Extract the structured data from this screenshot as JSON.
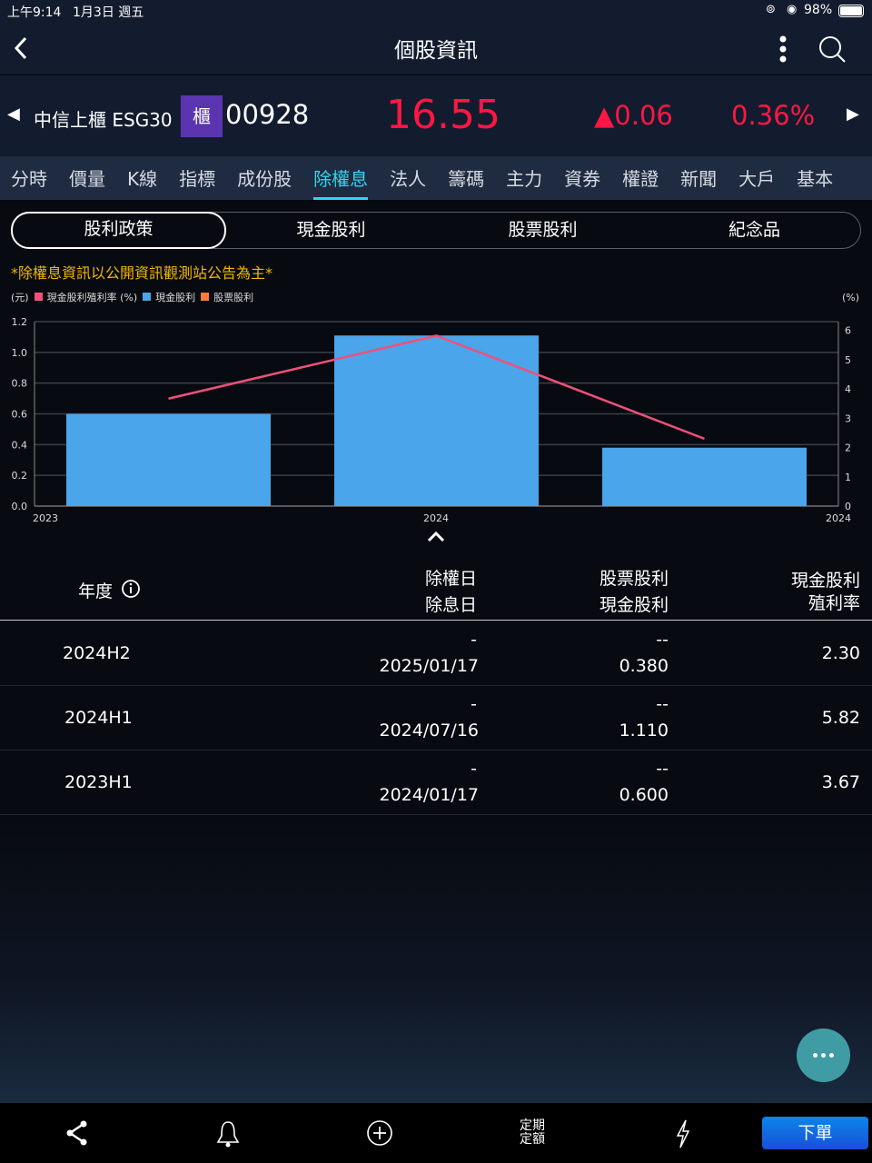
{
  "status": {
    "time": "上午9:14",
    "date": "1月3日 週五",
    "battery": "98%"
  },
  "header": {
    "title": "個股資訊"
  },
  "stock": {
    "name": "中信上櫃 ESG30",
    "market_badge": "櫃",
    "code": "00928",
    "price": "16.55",
    "change": "▲0.06",
    "change_pct": "0.36%",
    "badge_color": "#5b35b0",
    "up_color": "#ff1744"
  },
  "tabs": [
    "分時",
    "價量",
    "K線",
    "指標",
    "成份股",
    "除權息",
    "法人",
    "籌碼",
    "主力",
    "資券",
    "權證",
    "新聞",
    "大戶",
    "基本"
  ],
  "active_tab": "除權息",
  "segments": [
    "股利政策",
    "現金股利",
    "股票股利",
    "紀念品"
  ],
  "note": "*除權息資訊以公開資訊觀測站公告為主*",
  "chart_data": {
    "type": "bar",
    "left_unit": "(元)",
    "right_unit": "(%)",
    "legend": [
      {
        "label": "現金股利殖利率 (%)",
        "color": "#f0507a"
      },
      {
        "label": "現金股利",
        "color": "#4aa5ea"
      },
      {
        "label": "股票股利",
        "color": "#ff7a3a"
      }
    ],
    "categories": [
      "2023H1",
      "2024H1",
      "2024H2"
    ],
    "x_tick_labels": [
      "2023",
      "2024",
      "2024"
    ],
    "series": [
      {
        "name": "現金股利",
        "axis": "left",
        "type": "bar",
        "values": [
          0.6,
          1.11,
          0.38
        ]
      },
      {
        "name": "現金股利殖利率 (%)",
        "axis": "right",
        "type": "line",
        "values": [
          3.67,
          5.82,
          2.3
        ]
      }
    ],
    "ylim_left": [
      0,
      1.2
    ],
    "yticks_left": [
      "0.0",
      "0.2",
      "0.4",
      "0.6",
      "0.8",
      "1.0",
      "1.2"
    ],
    "ylim_right": [
      0,
      6.3
    ],
    "yticks_right": [
      "0",
      "1",
      "2",
      "3",
      "4",
      "5",
      "6"
    ],
    "grid": true
  },
  "table": {
    "headers": {
      "year": "年度",
      "ex_right": "除權日",
      "ex_div": "除息日",
      "stock_div": "股票股利",
      "cash_div": "現金股利",
      "yield1": "現金股利",
      "yield2": "殖利率"
    },
    "rows": [
      {
        "year": "2024H2",
        "ex_right": "-",
        "ex_div": "2025/01/17",
        "stock_div": "--",
        "cash_div": "0.380",
        "yield": "2.30"
      },
      {
        "year": "2024H1",
        "ex_right": "-",
        "ex_div": "2024/07/16",
        "stock_div": "--",
        "cash_div": "1.110",
        "yield": "5.82"
      },
      {
        "year": "2023H1",
        "ex_right": "-",
        "ex_div": "2024/01/17",
        "stock_div": "--",
        "cash_div": "0.600",
        "yield": "3.67"
      }
    ]
  },
  "bottom": {
    "regular_plan": "定期\n定額",
    "order": "下單"
  }
}
